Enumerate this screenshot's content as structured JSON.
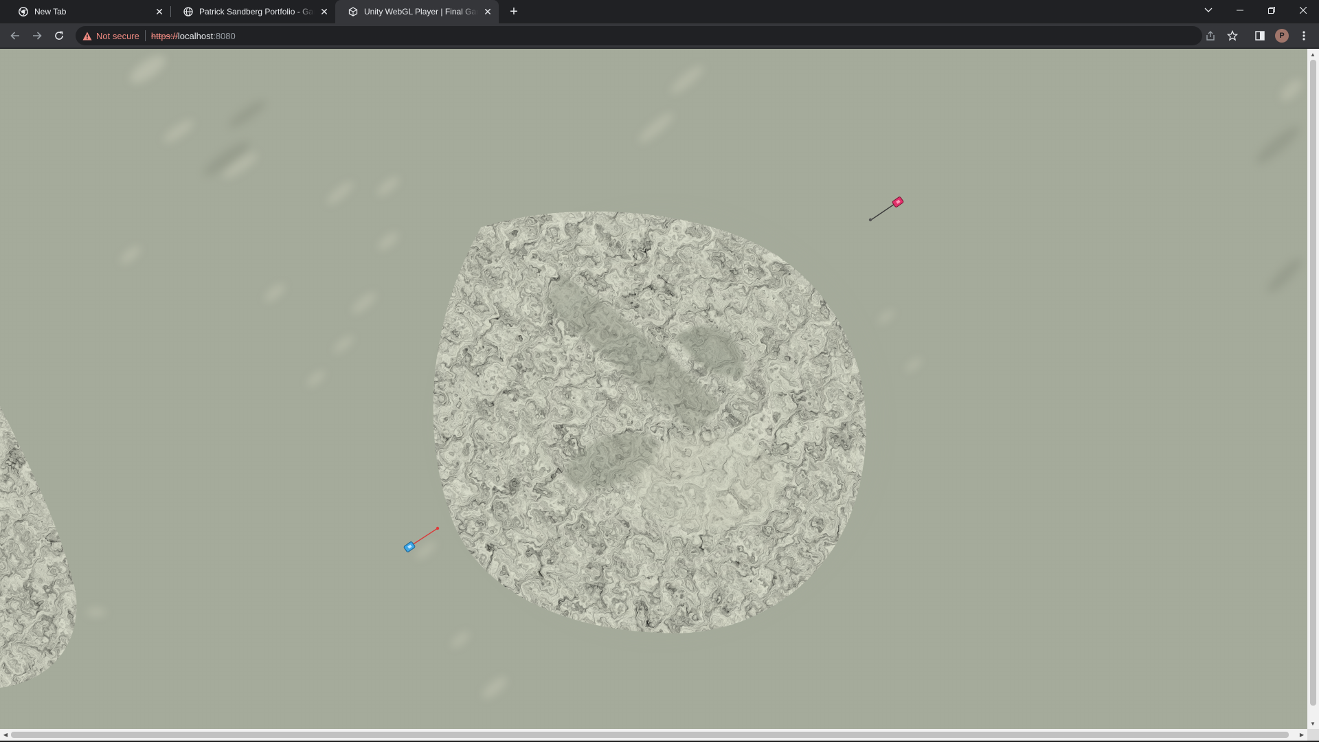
{
  "browser": {
    "tabs": [
      {
        "title": "New Tab",
        "icon": "chrome-icon",
        "active": false
      },
      {
        "title": "Patrick Sandberg Portfolio - Gam",
        "icon": "globe-icon",
        "active": false
      },
      {
        "title": "Unity WebGL Player | Final Game",
        "icon": "unity-icon",
        "active": true
      }
    ],
    "close_glyph": "✕",
    "new_tab_glyph": "+",
    "address": {
      "security_label": "Not secure",
      "scheme": "https://",
      "host": "localhost",
      "port": ":8080"
    },
    "profile_initial": "P",
    "colors": {
      "frame": "#202124",
      "toolbar": "#35363a",
      "warning": "#f28b82"
    }
  },
  "game": {
    "scene": "top-down terrain",
    "ground_color": "#a5ab9b",
    "units": [
      {
        "team": "red",
        "color": "#e0316b"
      },
      {
        "team": "blue",
        "color": "#3fa7e8"
      }
    ]
  }
}
